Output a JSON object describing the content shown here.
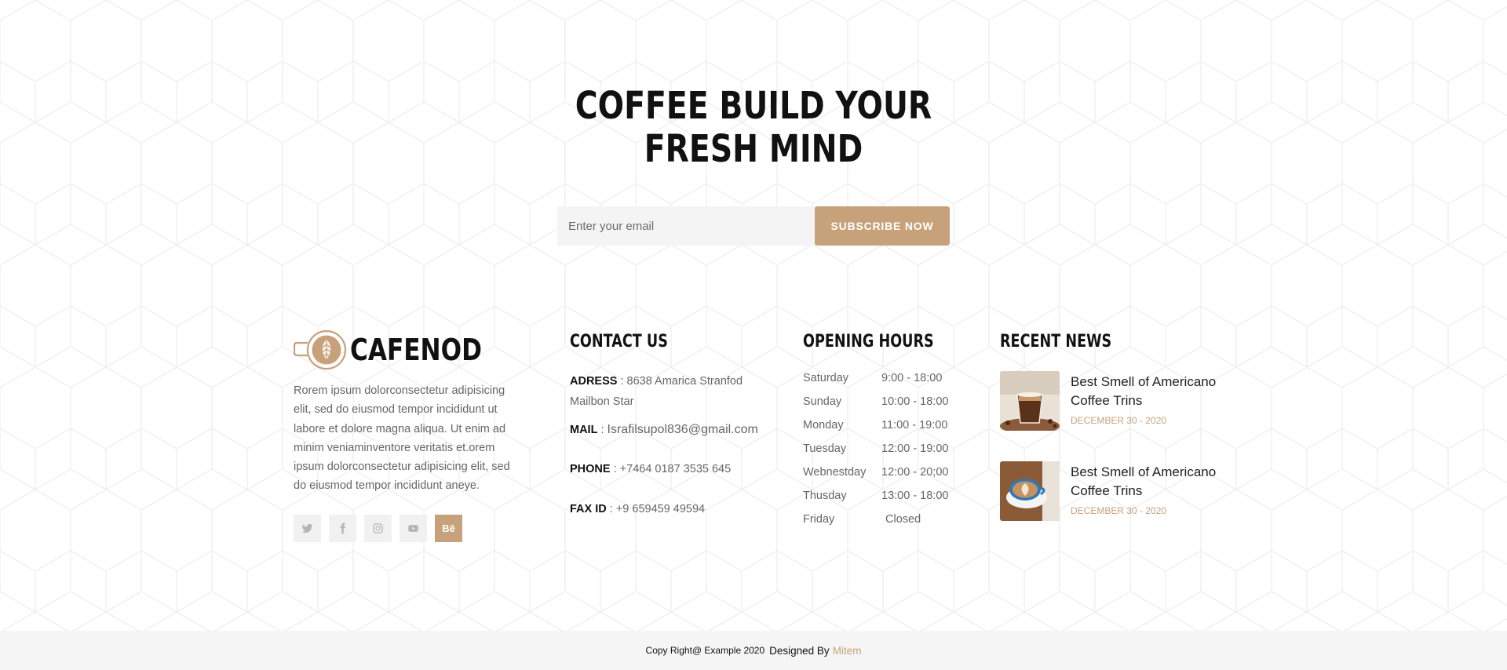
{
  "newsletter": {
    "title_line1": "COFFEE BUILD YOUR",
    "title_line2": "FRESH MIND",
    "email_placeholder": "Enter your email",
    "subscribe_label": "SUBSCRIBE NOW"
  },
  "about": {
    "brand": "CAFENOD",
    "text": "Rorem ipsum dolorconsectetur adipisicing elit, sed do eiusmod tempor incididunt ut labore et dolore magna aliqua. Ut enim ad minim veniaminventore veritatis et.orem ipsum dolorconsectetur adipisicing elit, sed do eiusmod tempor incididunt aneye.",
    "socials": [
      {
        "icon": "twitter-icon",
        "glyph": ""
      },
      {
        "icon": "facebook-icon",
        "glyph": "f"
      },
      {
        "icon": "instagram-icon",
        "glyph": ""
      },
      {
        "icon": "youtube-icon",
        "glyph": ""
      },
      {
        "icon": "behance-icon",
        "glyph": "Bē"
      }
    ]
  },
  "contact": {
    "heading": "CONTACT US",
    "address_label": "ADRESS",
    "address_value": "8638 Amarica Stranfod Mailbon Star",
    "mail_label": "MAIL",
    "mail_value": "Israfilsupol836@gmail.com",
    "phone_label": "PHONE",
    "phone_value": "+7464 0187 3535 645",
    "fax_label": "FAX ID",
    "fax_value": "+9 659459 49594"
  },
  "hours": {
    "heading": "OPENING HOURS",
    "rows": [
      {
        "day": "Saturday",
        "time": "9:00 - 18:00"
      },
      {
        "day": "Sunday",
        "time": "10:00 - 18:00"
      },
      {
        "day": "Monday",
        "time": "11:00 - 19:00"
      },
      {
        "day": "Tuesday",
        "time": "12:00 - 19:00"
      },
      {
        "day": "Webnestday",
        "time": "12:00 - 20;00"
      },
      {
        "day": "Thusday",
        "time": "13:00 - 18:00"
      },
      {
        "day": "Friday",
        "time": "Closed"
      }
    ]
  },
  "news": {
    "heading": "RECENT NEWS",
    "items": [
      {
        "title": "Best Smell of Americano Coffee Trins",
        "date": "DECEMBER 30 - 2020"
      },
      {
        "title": "Best Smell of Americano Coffee Trins",
        "date": "DECEMBER 30 - 2020"
      }
    ]
  },
  "footer_bar": {
    "copyright": "Copy Right@ Example 2020",
    "designed_by": "Designed By",
    "designer": "Mitem"
  },
  "colors": {
    "accent": "#c7a17a",
    "bottom_bar": "#f5f5f5"
  }
}
